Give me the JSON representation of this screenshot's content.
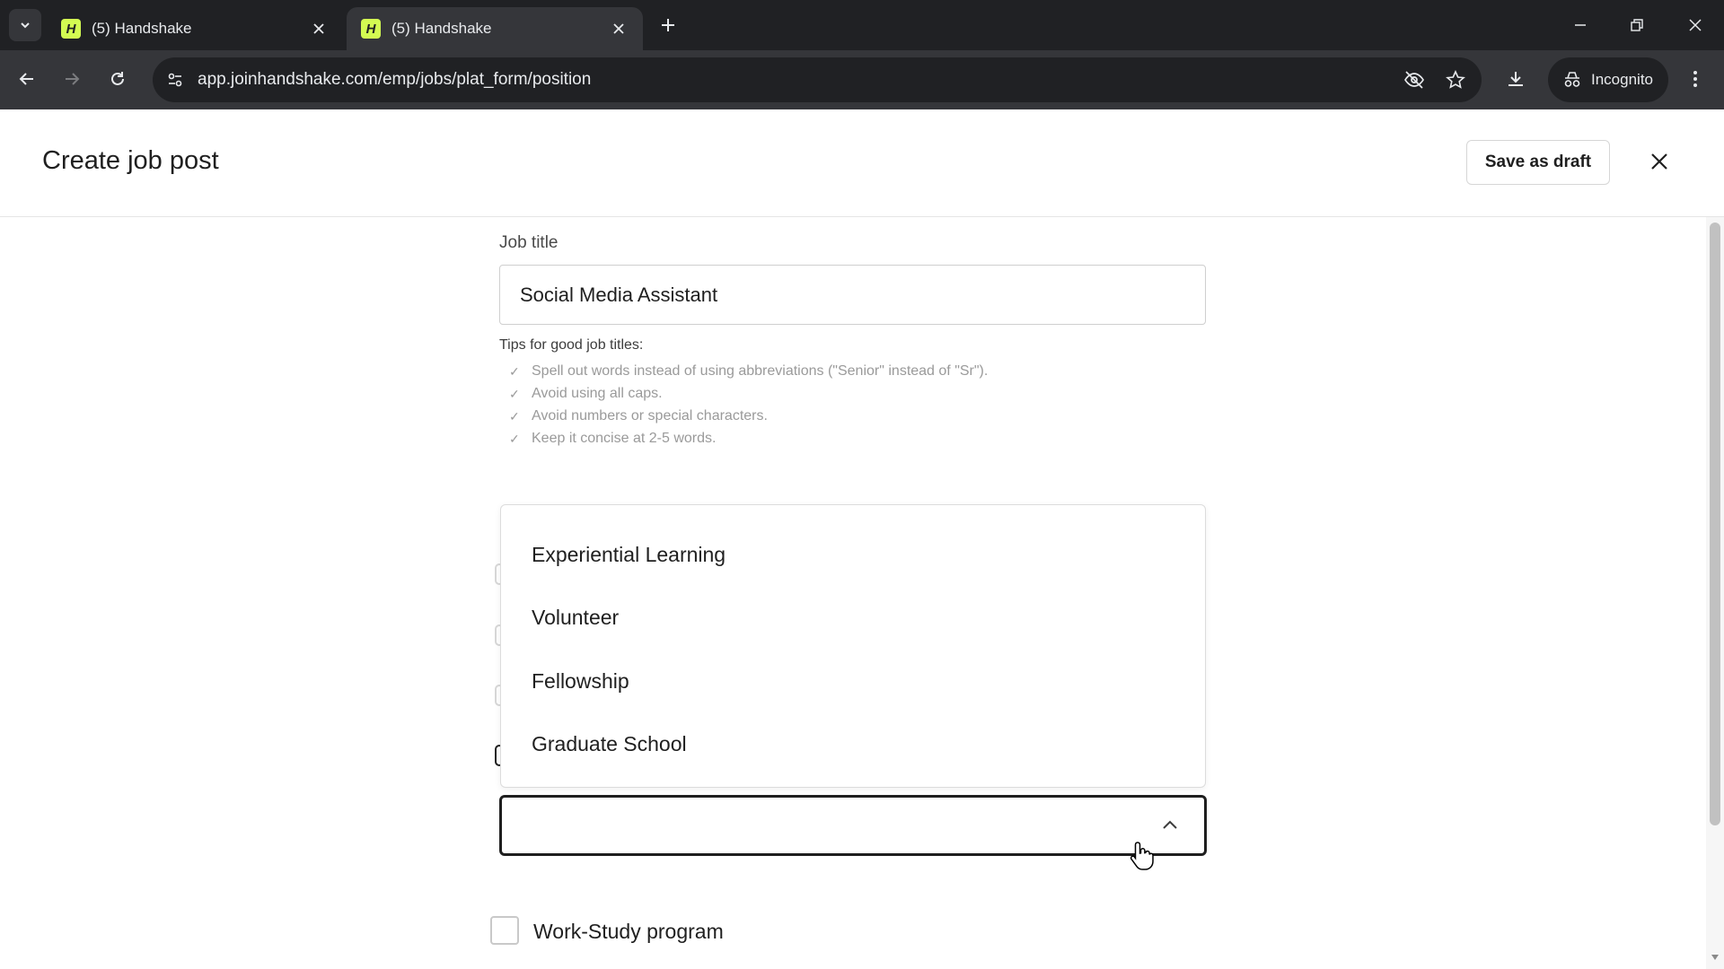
{
  "browser": {
    "tabs": [
      {
        "title": "(5) Handshake",
        "favicon": "H",
        "active": false
      },
      {
        "title": "(5) Handshake",
        "favicon": "H",
        "active": true
      }
    ],
    "url": "app.joinhandshake.com/emp/jobs/plat_form/position",
    "incognito_label": "Incognito"
  },
  "header": {
    "title": "Create job post",
    "save_draft_label": "Save as draft"
  },
  "form": {
    "job_title_label": "Job title",
    "job_title_value": "Social Media Assistant",
    "tips_title": "Tips for good job titles:",
    "tips": [
      "Spell out words instead of using abbreviations (\"Senior\" instead of \"Sr\").",
      "Avoid using all caps.",
      "Avoid numbers or special characters.",
      "Keep it concise at 2-5 words."
    ],
    "dropdown_options": [
      "Experiential Learning",
      "Volunteer",
      "Fellowship",
      "Graduate School"
    ],
    "select_value": "",
    "work_study_label": "Work-Study program"
  },
  "colors": {
    "chrome_dark": "#202124",
    "chrome_mid": "#35363a",
    "favicon_accent": "#d3fb52",
    "select_border": "#1f1f1f"
  }
}
